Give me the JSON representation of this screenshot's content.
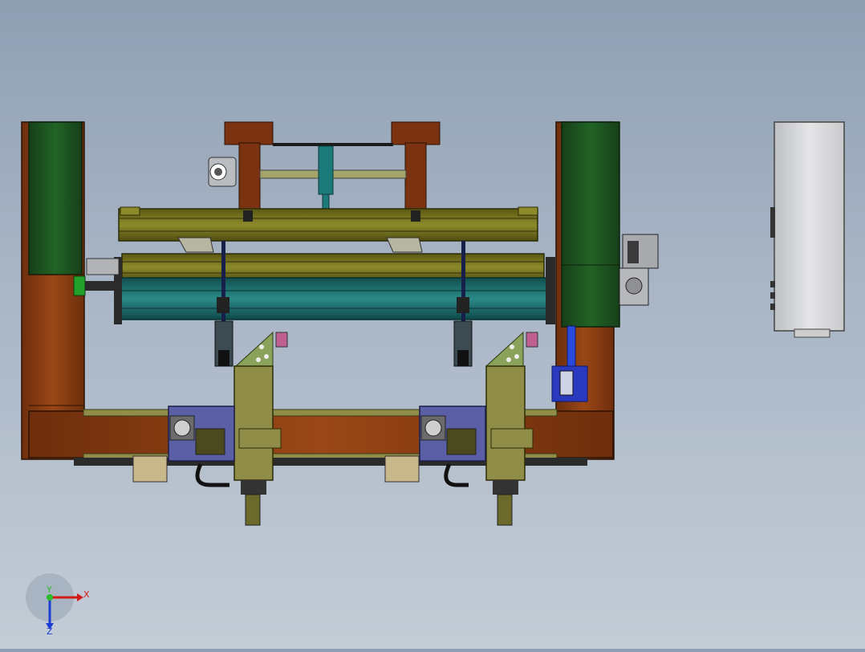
{
  "app": {
    "name": "CAD 3D viewport",
    "view": "front"
  },
  "triad": {
    "x_label": "X",
    "y_label": "Y",
    "z_label": "Z"
  },
  "colors": {
    "frame_brown": "#8b3d12",
    "frame_green": "#1e5a22",
    "rail_olive": "#7d7a1e",
    "roller_teal": "#1d7272",
    "carriage_blue": "#5a5fa6",
    "bracket_khaki": "#8f8d48",
    "cabinet_grey": "#d7d8da",
    "dark_motor": "#3a3a3a"
  },
  "model": {
    "components": [
      "left-column",
      "right-column",
      "top-gantry",
      "upper-rail",
      "middle-rail",
      "teal-roller",
      "left-carriage",
      "right-carriage",
      "left-tool-head",
      "right-tool-head",
      "gear-motor",
      "control-cabinet",
      "bottom-base-beam"
    ]
  }
}
